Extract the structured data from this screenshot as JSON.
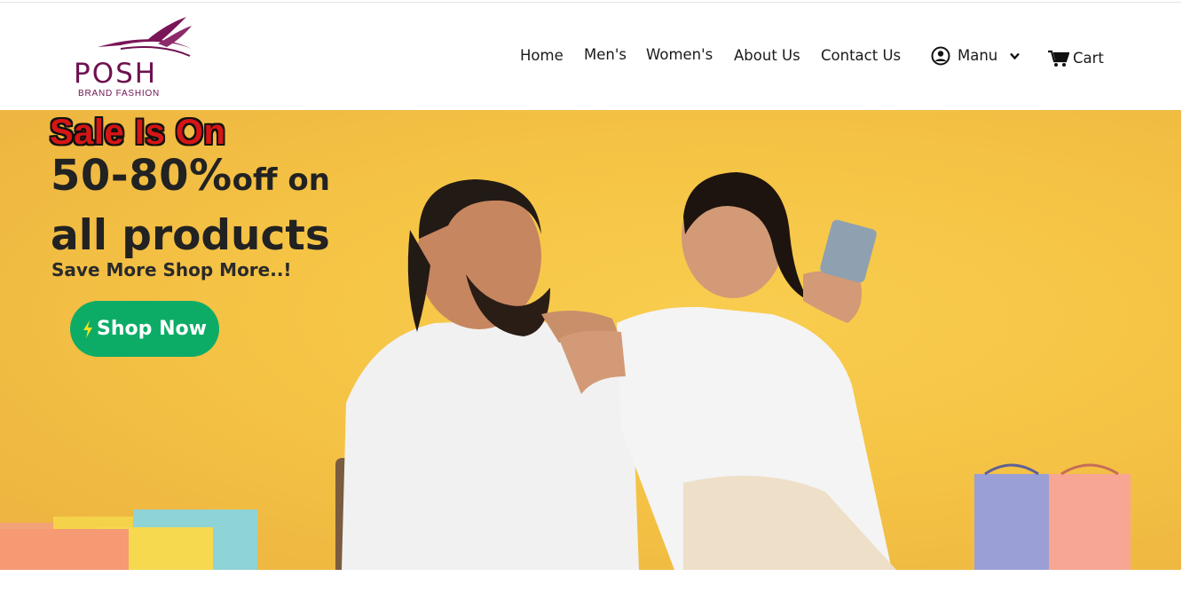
{
  "brand": {
    "name": "POSH",
    "subtitle": "BRAND FASHION",
    "color": "#6e1150"
  },
  "nav": {
    "items": [
      {
        "label": "Home"
      },
      {
        "label": "Men's"
      },
      {
        "label": "Women's"
      },
      {
        "label": "About Us"
      },
      {
        "label": "Contact Us"
      }
    ],
    "menu_label": "Manu",
    "cart_label": "Cart",
    "icons": {
      "menu": "user-circle-icon",
      "dropdown": "chevron-down-icon",
      "cart": "cart-icon"
    }
  },
  "hero": {
    "badge": "Sale Is On",
    "headline_big": "50-80%",
    "headline_small": "off on",
    "headline_line2": "all products",
    "tagline": "Save More Shop More..!",
    "cta_label": "Shop Now",
    "cta_icon": "lightning-icon",
    "colors": {
      "background": "#f5c445",
      "cta": "#0cac66",
      "badge": "#d61515"
    }
  }
}
